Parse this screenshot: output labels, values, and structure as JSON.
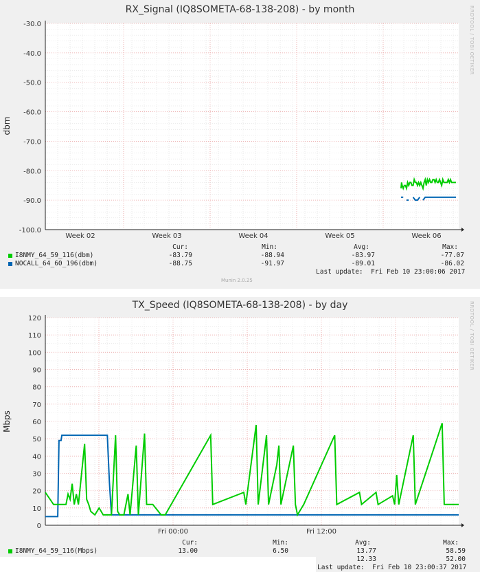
{
  "charts": [
    {
      "type": "line",
      "title": "RX_Signal (IQ8SOMETA-68-138-208) - by month",
      "ylabel": "dbm",
      "ylim": [
        -100,
        -30
      ],
      "yticks": [
        "-30.0",
        "-40.0",
        "-50.0",
        "-60.0",
        "-70.0",
        "-80.0",
        "-90.0",
        "-100.0"
      ],
      "ytick_values": [
        -30,
        -40,
        -50,
        -60,
        -70,
        -80,
        -90,
        -100
      ],
      "xticks": [
        "Week 02",
        "Week 03",
        "Week 04",
        "Week 05",
        "Week 06"
      ],
      "side_text": "RRDTOOL / TOBI OETIKER",
      "colors": {
        "series1": "#00cc00",
        "series2": "#0066b3",
        "grid": "#e9a0a0",
        "minor": "#dadada"
      },
      "legend_headers": {
        "cur": "Cur:",
        "min": "Min:",
        "avg": "Avg:",
        "max": "Max:"
      },
      "series": [
        {
          "name": "I8NMY_64_59_116(dbm)",
          "color": "#00cc00",
          "cur": "-83.79",
          "min": "-88.94",
          "avg": "-83.97",
          "max": "-77.07",
          "points": [
            [
              0.0,
              -86
            ],
            [
              0.01,
              -84
            ],
            [
              0.02,
              -85
            ],
            [
              0.04,
              -86
            ],
            [
              0.06,
              -85
            ],
            [
              0.08,
              -85
            ],
            [
              0.1,
              -86
            ],
            [
              0.12,
              -84
            ],
            [
              0.14,
              -85
            ],
            [
              0.16,
              -84
            ],
            [
              0.18,
              -84
            ],
            [
              0.2,
              -85
            ],
            [
              0.22,
              -85
            ],
            [
              0.24,
              -83
            ],
            [
              0.26,
              -84
            ],
            [
              0.28,
              -84
            ],
            [
              0.3,
              -85
            ],
            [
              0.32,
              -84
            ],
            [
              0.34,
              -85
            ],
            [
              0.36,
              -84
            ],
            [
              0.38,
              -85
            ],
            [
              0.4,
              -86
            ],
            [
              0.42,
              -84
            ],
            [
              0.44,
              -83
            ],
            [
              0.46,
              -85
            ],
            [
              0.48,
              -83
            ],
            [
              0.5,
              -84
            ],
            [
              0.52,
              -83
            ],
            [
              0.54,
              -84
            ],
            [
              0.56,
              -84
            ],
            [
              0.58,
              -83
            ],
            [
              0.6,
              -83
            ],
            [
              0.62,
              -84
            ],
            [
              0.64,
              -83
            ],
            [
              0.66,
              -84
            ],
            [
              0.68,
              -84
            ],
            [
              0.7,
              -83
            ],
            [
              0.72,
              -84
            ],
            [
              0.74,
              -85
            ],
            [
              0.76,
              -83
            ],
            [
              0.78,
              -84
            ],
            [
              0.8,
              -84
            ],
            [
              0.82,
              -84
            ],
            [
              0.84,
              -84
            ],
            [
              0.86,
              -83
            ],
            [
              0.88,
              -84
            ],
            [
              0.9,
              -83
            ],
            [
              0.92,
              -84
            ],
            [
              0.94,
              -84
            ],
            [
              0.96,
              -84
            ],
            [
              1.0,
              -84
            ]
          ]
        },
        {
          "name": "NOCALL_64_60_196(dbm)",
          "color": "#0066b3",
          "cur": "-88.75",
          "min": "-91.97",
          "avg": "-89.01",
          "max": "-86.02",
          "points": [
            [
              0.0,
              -89
            ],
            [
              0.04,
              -89
            ],
            [
              0.05,
              null
            ],
            [
              0.1,
              -90
            ],
            [
              0.14,
              -90
            ],
            [
              0.18,
              null
            ],
            [
              0.22,
              -89
            ],
            [
              0.26,
              -90
            ],
            [
              0.3,
              -90
            ],
            [
              0.34,
              -89
            ],
            [
              0.38,
              null
            ],
            [
              0.4,
              -90
            ],
            [
              0.44,
              -89
            ],
            [
              0.46,
              -89
            ],
            [
              0.5,
              -89
            ],
            [
              0.54,
              -89
            ],
            [
              0.58,
              -89
            ],
            [
              0.62,
              -89
            ],
            [
              0.66,
              -89
            ],
            [
              0.7,
              -89
            ],
            [
              0.74,
              -89
            ],
            [
              0.78,
              -89
            ],
            [
              0.82,
              -89
            ],
            [
              0.86,
              -89
            ],
            [
              0.9,
              -89
            ],
            [
              0.94,
              -89
            ],
            [
              1.0,
              -89
            ]
          ]
        }
      ],
      "last_update": "Last update:  Fri Feb 10 23:00:06 2017",
      "munin": "Munin 2.0.25"
    },
    {
      "type": "line",
      "title": "TX_Speed (IQ8SOMETA-68-138-208) - by day",
      "ylabel": "Mbps",
      "ylim": [
        0,
        120
      ],
      "yticks": [
        "120",
        "110",
        "100",
        "90",
        "80",
        "70",
        "60",
        "50",
        "40",
        "30",
        "20",
        "10",
        "0"
      ],
      "ytick_values": [
        120,
        110,
        100,
        90,
        80,
        70,
        60,
        50,
        40,
        30,
        20,
        10,
        0
      ],
      "xticks": [
        "Fri 00:00",
        "Fri 12:00"
      ],
      "side_text": "RRDTOOL / TOBI OETIKER",
      "colors": {
        "series1": "#00cc00",
        "series2": "#0066b3",
        "grid": "#e9a0a0",
        "minor": "#dadada"
      },
      "legend_headers": {
        "cur": "Cur:",
        "min": "Min:",
        "avg": "Avg:",
        "max": "Max:"
      },
      "series": [
        {
          "name": "I8NMY_64_59_116(Mbps)",
          "color": "#00cc00",
          "cur": "13.00",
          "min": "6.50",
          "avg": "13.77",
          "max": "58.59",
          "peaks": [
            [
              0.0,
              19
            ],
            [
              0.02,
              12
            ],
            [
              0.05,
              12
            ],
            [
              0.055,
              18
            ],
            [
              0.06,
              15
            ],
            [
              0.065,
              24
            ],
            [
              0.07,
              12
            ],
            [
              0.075,
              18
            ],
            [
              0.08,
              12
            ],
            [
              0.095,
              47
            ],
            [
              0.1,
              15
            ],
            [
              0.105,
              12
            ],
            [
              0.11,
              8
            ],
            [
              0.12,
              6
            ],
            [
              0.13,
              10
            ],
            [
              0.14,
              6
            ],
            [
              0.16,
              6
            ],
            [
              0.17,
              52
            ],
            [
              0.175,
              8
            ],
            [
              0.18,
              6
            ],
            [
              0.19,
              6
            ],
            [
              0.2,
              18
            ],
            [
              0.205,
              6
            ],
            [
              0.22,
              46
            ],
            [
              0.225,
              6
            ],
            [
              0.24,
              53
            ],
            [
              0.245,
              12
            ],
            [
              0.26,
              12
            ],
            [
              0.28,
              6
            ],
            [
              0.29,
              6
            ],
            [
              0.4,
              52
            ],
            [
              0.405,
              12
            ],
            [
              0.48,
              19
            ],
            [
              0.485,
              12
            ],
            [
              0.51,
              58
            ],
            [
              0.515,
              12
            ],
            [
              0.535,
              52
            ],
            [
              0.54,
              12
            ],
            [
              0.56,
              35
            ],
            [
              0.565,
              46
            ],
            [
              0.57,
              12
            ],
            [
              0.6,
              46
            ],
            [
              0.605,
              12
            ],
            [
              0.61,
              6
            ],
            [
              0.625,
              12
            ],
            [
              0.7,
              52
            ],
            [
              0.705,
              12
            ],
            [
              0.76,
              19
            ],
            [
              0.765,
              12
            ],
            [
              0.8,
              19
            ],
            [
              0.805,
              12
            ],
            [
              0.84,
              17
            ],
            [
              0.845,
              12
            ],
            [
              0.85,
              29
            ],
            [
              0.855,
              12
            ],
            [
              0.89,
              52
            ],
            [
              0.895,
              12
            ],
            [
              0.96,
              59
            ],
            [
              0.965,
              12
            ],
            [
              0.98,
              12
            ],
            [
              1.0,
              12
            ]
          ]
        },
        {
          "name": "",
          "color": "#0066b3",
          "cur": "",
          "min": "",
          "avg": "12.33",
          "max": "52.00"
        }
      ],
      "last_update": "Last update:  Fri Feb 10 23:00:37 2017"
    }
  ],
  "chart_data": [
    {
      "type": "line",
      "title": "RX_Signal (IQ8SOMETA-68-138-208) - by month",
      "ylabel": "dbm",
      "ylim": [
        -100,
        -30
      ],
      "x": [
        "Week 02",
        "Week 03",
        "Week 04",
        "Week 05",
        "Week 06"
      ],
      "series": [
        {
          "name": "I8NMY_64_59_116(dbm)",
          "cur": -83.79,
          "min": -88.94,
          "avg": -83.97,
          "max": -77.07
        },
        {
          "name": "NOCALL_64_60_196(dbm)",
          "cur": -88.75,
          "min": -91.97,
          "avg": -89.01,
          "max": -86.02
        }
      ]
    },
    {
      "type": "line",
      "title": "TX_Speed (IQ8SOMETA-68-138-208) - by day",
      "ylabel": "Mbps",
      "ylim": [
        0,
        120
      ],
      "x": [
        "Fri 00:00",
        "Fri 12:00"
      ],
      "series": [
        {
          "name": "I8NMY_64_59_116(Mbps)",
          "cur": 13.0,
          "min": 6.5,
          "avg": 13.77,
          "max": 58.59
        },
        {
          "avg": 12.33,
          "max": 52.0
        }
      ]
    }
  ]
}
